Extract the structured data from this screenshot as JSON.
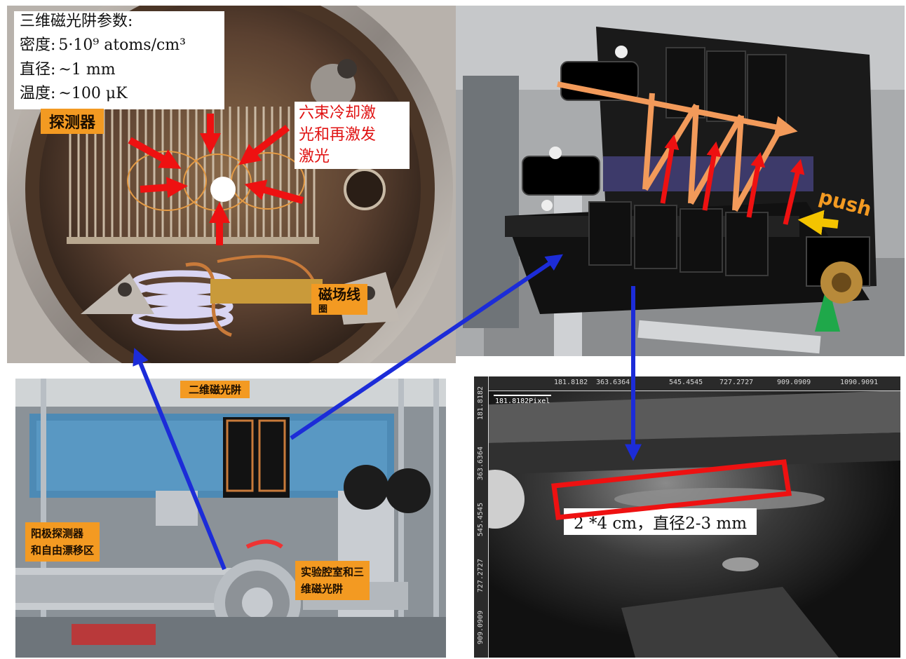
{
  "mot3d": {
    "title": "三维磁光阱参数:",
    "density_label": "密度:",
    "density_value": "5·10⁹ atoms/cm³",
    "diameter_label": "直径:",
    "diameter_value": "~1 mm",
    "temperature_label": "温度:",
    "temperature_value": "~100 μK"
  },
  "labels": {
    "detector": "探测器",
    "six_beam_line1": "六束冷却激",
    "six_beam_line2": "光和再激发",
    "six_beam_line3": "激光",
    "coil_line1": "磁场线",
    "coil_line2": "圈",
    "push": "push",
    "mot2d": "二维磁光阱",
    "anode_line1": "阳极探测器",
    "anode_line2": "和自由漂移区",
    "chamber_line1": "实验腔室和三",
    "chamber_line2": "维磁光阱",
    "beam_dim": "2 *4 cm，直径2-3 mm"
  },
  "camera": {
    "x_ticks": [
      "181.8182",
      "363.6364",
      "545.4545",
      "727.2727",
      "909.0909",
      "1090.9091"
    ],
    "y_ticks": [
      "181.8182",
      "363.6364",
      "545.4545",
      "727.2727",
      "909.0909"
    ],
    "scalebar": "181.8182Pixel"
  },
  "colors": {
    "laser_arrow": "#ee1111",
    "push_arrow": "#f4c400",
    "beam_arrow": "#f29a5a",
    "link_arrow": "#1c2cd8",
    "label_bg": "#f39a22"
  }
}
